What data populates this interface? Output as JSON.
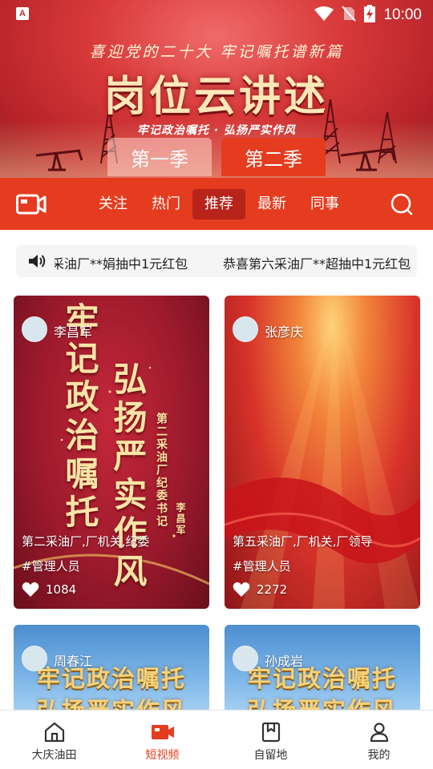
{
  "status_bar": {
    "time": "10:00",
    "app_icon_letter": "A"
  },
  "hero": {
    "slogan": "喜迎党的二十大   牢记嘱托谱新篇",
    "title": "岗位云讲述",
    "subtitle": "牢记政治嘱托 · 弘扬严实作风",
    "seasons": [
      {
        "label": "第一季",
        "active": false
      },
      {
        "label": "第二季",
        "active": true
      }
    ]
  },
  "category_nav": {
    "tabs": [
      {
        "label": "关注",
        "active": false
      },
      {
        "label": "热门",
        "active": false
      },
      {
        "label": "推荐",
        "active": true
      },
      {
        "label": "最新",
        "active": false
      },
      {
        "label": "同事",
        "active": false
      }
    ]
  },
  "ticker": {
    "messages": [
      "采油厂**娟抽中1元红包",
      "恭喜第六采油厂**超抽中1元红包"
    ]
  },
  "cards": [
    {
      "author": "李昌军",
      "department": "第二采油厂,厂机关,纪委",
      "tag": "#管理人员",
      "likes": "1084",
      "art_lines": [
        "牢记政治嘱托",
        "弘扬严实作风",
        "第二采油厂纪委书记",
        "李昌军"
      ]
    },
    {
      "author": "张彦庆",
      "department": "第五采油厂,厂机关,厂领导",
      "tag": "#管理人员",
      "likes": "2272"
    },
    {
      "author": "周春江",
      "art_lines": [
        "牢记政治嘱托",
        "弘扬严实作风"
      ]
    },
    {
      "author": "孙成岩",
      "art_lines": [
        "牢记政治嘱托",
        "弘扬严实作风"
      ]
    }
  ],
  "bottom_nav": {
    "items": [
      {
        "label": "大庆油田",
        "icon": "home-icon",
        "active": false
      },
      {
        "label": "短视频",
        "icon": "video-camera-icon",
        "active": true
      },
      {
        "label": "自留地",
        "icon": "bookmark-icon",
        "active": false
      },
      {
        "label": "我的",
        "icon": "person-icon",
        "active": false
      }
    ]
  },
  "colors": {
    "brand_red": "#e53c1f",
    "active_tab_bg": "#b8231a",
    "text_dark": "#333333"
  }
}
